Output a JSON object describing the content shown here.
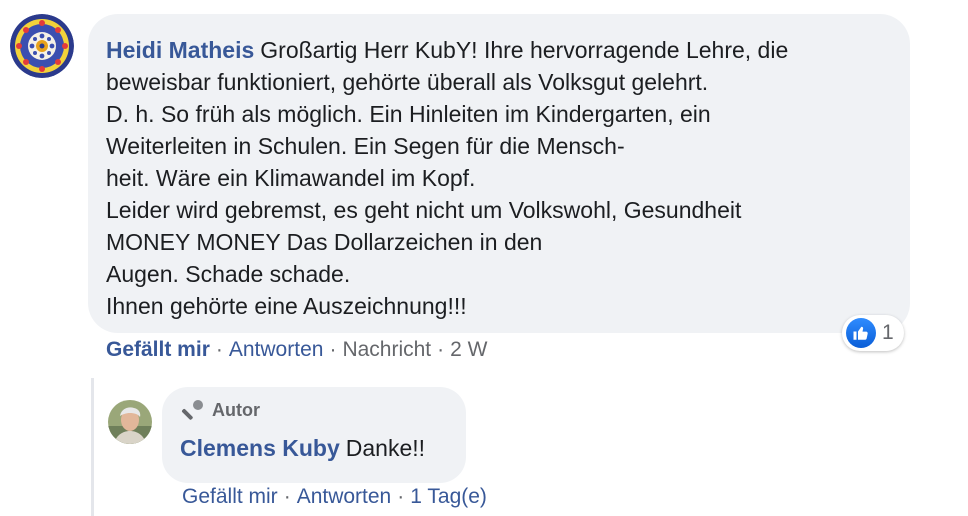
{
  "comment": {
    "author": "Heidi Matheis",
    "lines": [
      "Großartig Herr KubY! Ihre hervorragende Lehre, die",
      "beweisbar funktioniert, gehörte überall als Volksgut gelehrt.",
      "D. h. So früh als möglich. Ein Hinleiten im Kindergarten, ein",
      "Weiterleiten in Schulen. Ein Segen für die Mensch-",
      "heit. Wäre ein Klimawandel im Kopf.",
      "Leider wird gebremst, es geht nicht um Volkswohl, Gesundheit",
      "MONEY MONEY Das Dollarzeichen in den",
      "Augen. Schade schade.",
      "Ihnen gehörte eine Auszeichnung!!!"
    ],
    "reaction_count": "1",
    "actions": {
      "like": "Gefällt mir",
      "reply": "Antworten",
      "message": "Nachricht",
      "time": "2 W",
      "separator": "·"
    }
  },
  "reply": {
    "badge": "Autor",
    "author": "Clemens Kuby",
    "text": "Danke!!",
    "actions": {
      "like": "Gefällt mir",
      "reply": "Antworten",
      "time": "1 Tag(e)",
      "separator": "·"
    }
  },
  "colors": {
    "link": "#385898",
    "bubble": "#f0f2f5",
    "muted": "#65676b",
    "like_blue": "#1877f2"
  }
}
